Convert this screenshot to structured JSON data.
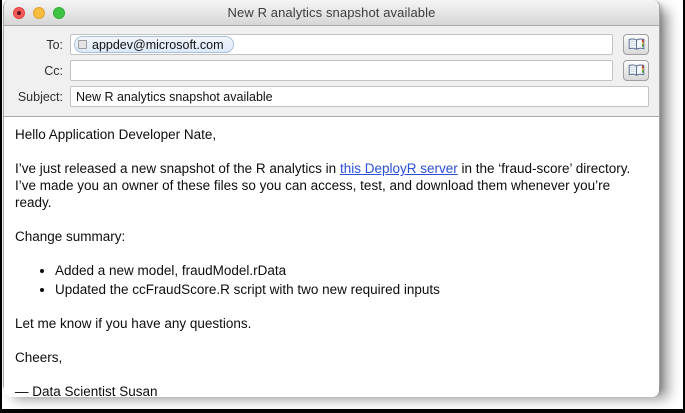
{
  "window": {
    "title": "New R analytics snapshot available",
    "traffic_lights": {
      "close": "close-button-with-edited-dot",
      "minimize": "minimize-button",
      "zoom": "zoom-button"
    }
  },
  "header": {
    "to": {
      "label": "To:",
      "token": "appdev@microsoft.com",
      "token_icon": "contact-card-icon"
    },
    "cc": {
      "label": "Cc:",
      "value": ""
    },
    "subject": {
      "label": "Subject:",
      "value": "New R analytics snapshot available"
    },
    "address_book_icon": "address-book-icon"
  },
  "body": {
    "greeting": "Hello Application Developer Nate,",
    "para1_before_link": "I’ve just released a new snapshot of the R analytics in ",
    "para1_link": "this DeployR server",
    "para1_after_link": " in the ‘fraud-score’ directory.  I’ve made you an owner of these files so you can access, test, and download them whenever you’re ready.",
    "change_summary": "Change summary:",
    "bullets": [
      "Added a new model, fraudModel.rData",
      "Updated the ccFraudScore.R script with two new required inputs"
    ],
    "closing": "Let me know if you have any questions.",
    "signoff": "Cheers,",
    "signature": "— Data Scientist Susan"
  },
  "colors": {
    "link": "#2a4fd6",
    "titlebar_top": "#f5f5f5",
    "titlebar_bottom": "#d6d6d6",
    "header_bg": "#f0f0f0",
    "traffic_red": "#f7595c",
    "traffic_yellow": "#f6bd3e",
    "traffic_green": "#3ec444",
    "token_border": "#a9c0dd"
  }
}
